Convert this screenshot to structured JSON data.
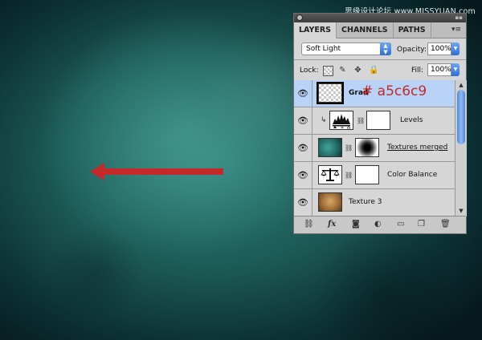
{
  "watermark": "思缘设计论坛 www.MISSYUAN.com",
  "colors": {
    "annotation": "#c42a2a",
    "selected_row": "#b9d3f7",
    "arrow": "#c42a2a"
  },
  "panel": {
    "tabs": [
      "LAYERS",
      "CHANNELS",
      "PATHS"
    ],
    "blend_mode": "Soft Light",
    "opacity_label": "Opacity:",
    "opacity_value": "100%",
    "lock_label": "Lock:",
    "fill_label": "Fill:",
    "fill_value": "100%",
    "annotation": "# a5c6c9",
    "layers": [
      {
        "name": "Grad",
        "thumb": "transparent-checker",
        "selected": true
      },
      {
        "name": "Levels",
        "thumb": "levels-adjustment-icon",
        "mask": "white",
        "clipped": true
      },
      {
        "name": "Textures merged",
        "thumb": "teal-texture",
        "mask": "radial-black"
      },
      {
        "name": "Color Balance",
        "thumb": "color-balance-adjustment-icon",
        "mask": "white"
      },
      {
        "name": "Texture 3",
        "thumb": "brown-texture"
      }
    ],
    "bottom_icons": [
      "link-layers-icon",
      "fx-icon",
      "add-mask-icon",
      "adjustment-layer-icon",
      "group-folder-icon",
      "new-layer-icon",
      "trash-icon"
    ],
    "bottom_labels": {
      "fx": "fx"
    }
  }
}
